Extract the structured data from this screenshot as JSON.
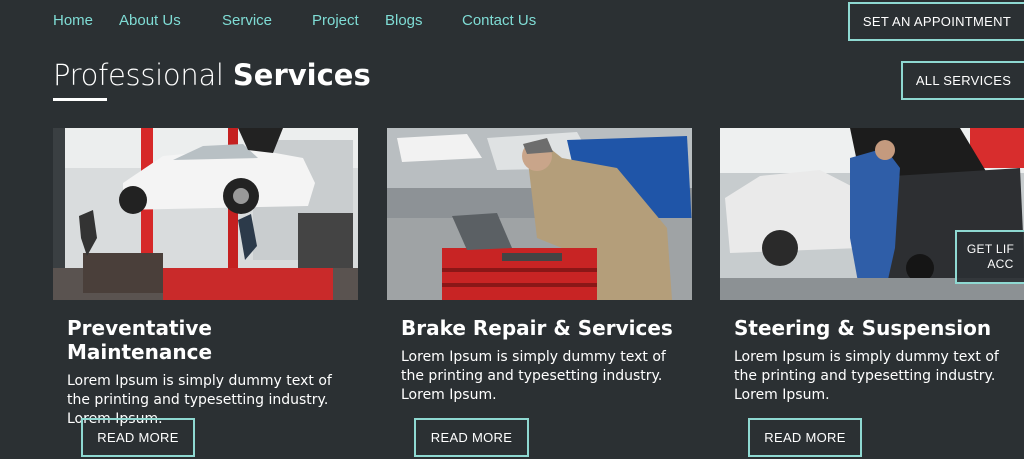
{
  "nav": {
    "items": [
      "Home",
      "About Us",
      "Service",
      "Project",
      "Blogs",
      "Contact Us"
    ],
    "cta": "SET AN APPOINTMENT"
  },
  "section": {
    "title_light": "Professional",
    "title_bold": "Services",
    "all_services": "ALL SERVICES"
  },
  "cards": [
    {
      "title": "Preventative Maintenance",
      "text": "Lorem Ipsum is simply dummy text of the printing and typesetting industry. Lorem Ipsum.",
      "button": "READ MORE",
      "image": "car-on-lift-garage-photo"
    },
    {
      "title": "Brake Repair & Services",
      "text": "Lorem Ipsum is simply dummy text of the printing and typesetting industry. Lorem Ipsum.",
      "button": "READ MORE",
      "image": "mechanic-laptop-photo"
    },
    {
      "title": "Steering & Suspension",
      "text": "Lorem Ipsum is simply dummy text of the printing and typesetting industry. Lorem Ipsum.",
      "button": "READ MORE",
      "image": "mechanic-engine-photo"
    }
  ],
  "floating_button": {
    "line1": "GET LIF",
    "line2": "ACC"
  },
  "colors": {
    "background": "#2b3033",
    "accent": "#7fdcd5",
    "border": "#8fd9d2"
  }
}
